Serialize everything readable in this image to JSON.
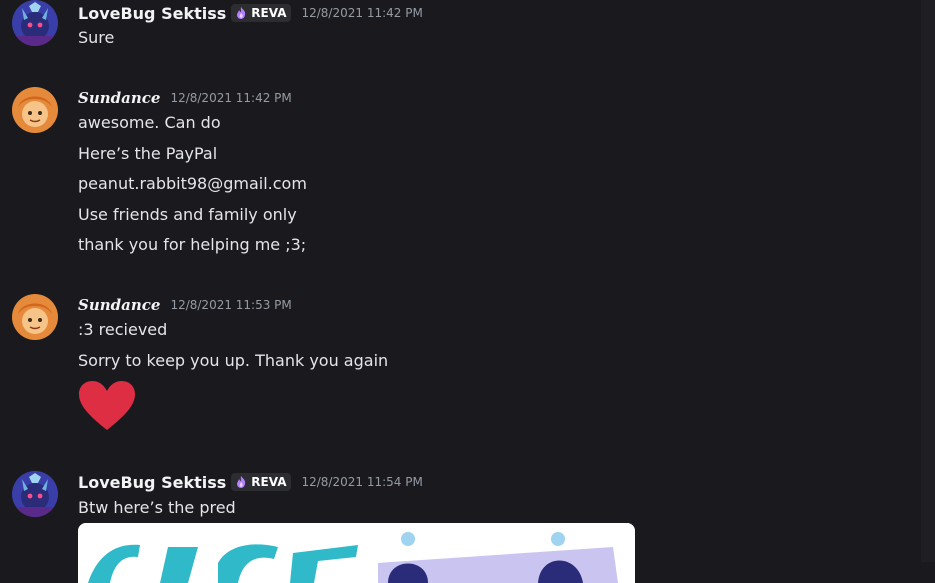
{
  "colors": {
    "background": "#1a1a1e",
    "username": "#f2f3f5",
    "timestamp": "#949ba4",
    "text": "#e3e5e8",
    "heart": "#dd2e44",
    "tag_icon": "#b57cff"
  },
  "messages": [
    {
      "author": "LoveBug Sektiss",
      "tag": "REVA",
      "tag_icon": "flame-icon",
      "timestamp": "12/8/2021 11:42 PM",
      "lines": [
        "Sure"
      ]
    },
    {
      "author": "Sundance",
      "timestamp": "12/8/2021 11:42 PM",
      "lines": [
        "awesome. Can do",
        "Here’s the PayPal",
        "peanut.rabbit98@gmail.com",
        "Use friends and family only",
        "thank you for helping me ;3;"
      ]
    },
    {
      "author": "Sundance",
      "timestamp": "12/8/2021 11:53 PM",
      "lines": [
        ":3 recieved",
        "Sorry to keep you up. Thank you again"
      ],
      "emoji": "heart-emoji"
    },
    {
      "author": "LoveBug Sektiss",
      "tag": "REVA",
      "tag_icon": "flame-icon",
      "timestamp": "12/8/2021 11:54 PM",
      "lines": [
        "Btw here’s the pred"
      ],
      "attachment": "image-attachment"
    }
  ]
}
